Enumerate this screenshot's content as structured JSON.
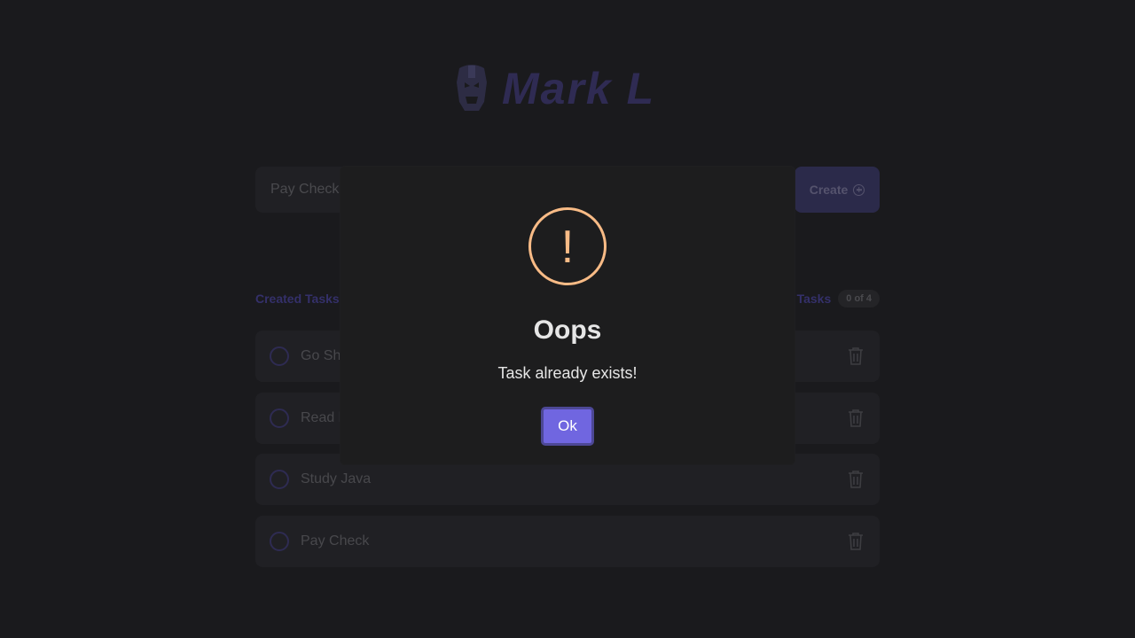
{
  "header": {
    "logo_text": "Mark L"
  },
  "form": {
    "input_value": "Pay Check",
    "create_label": "Create"
  },
  "counters": {
    "created_label": "Created Tasks",
    "done_label": "Tasks",
    "done_badge": "0 of 4"
  },
  "tasks": [
    {
      "title": "Go Sh"
    },
    {
      "title": "Read l"
    },
    {
      "title": "Study Java"
    },
    {
      "title": "Pay Check"
    }
  ],
  "modal": {
    "icon": "exclamation-icon",
    "icon_glyph": "!",
    "title": "Oops",
    "message": "Task already exists!",
    "ok_label": "Ok"
  },
  "colors": {
    "background": "#1a1a1d",
    "accent": "#7066e0",
    "warning": "#f8bb86"
  }
}
